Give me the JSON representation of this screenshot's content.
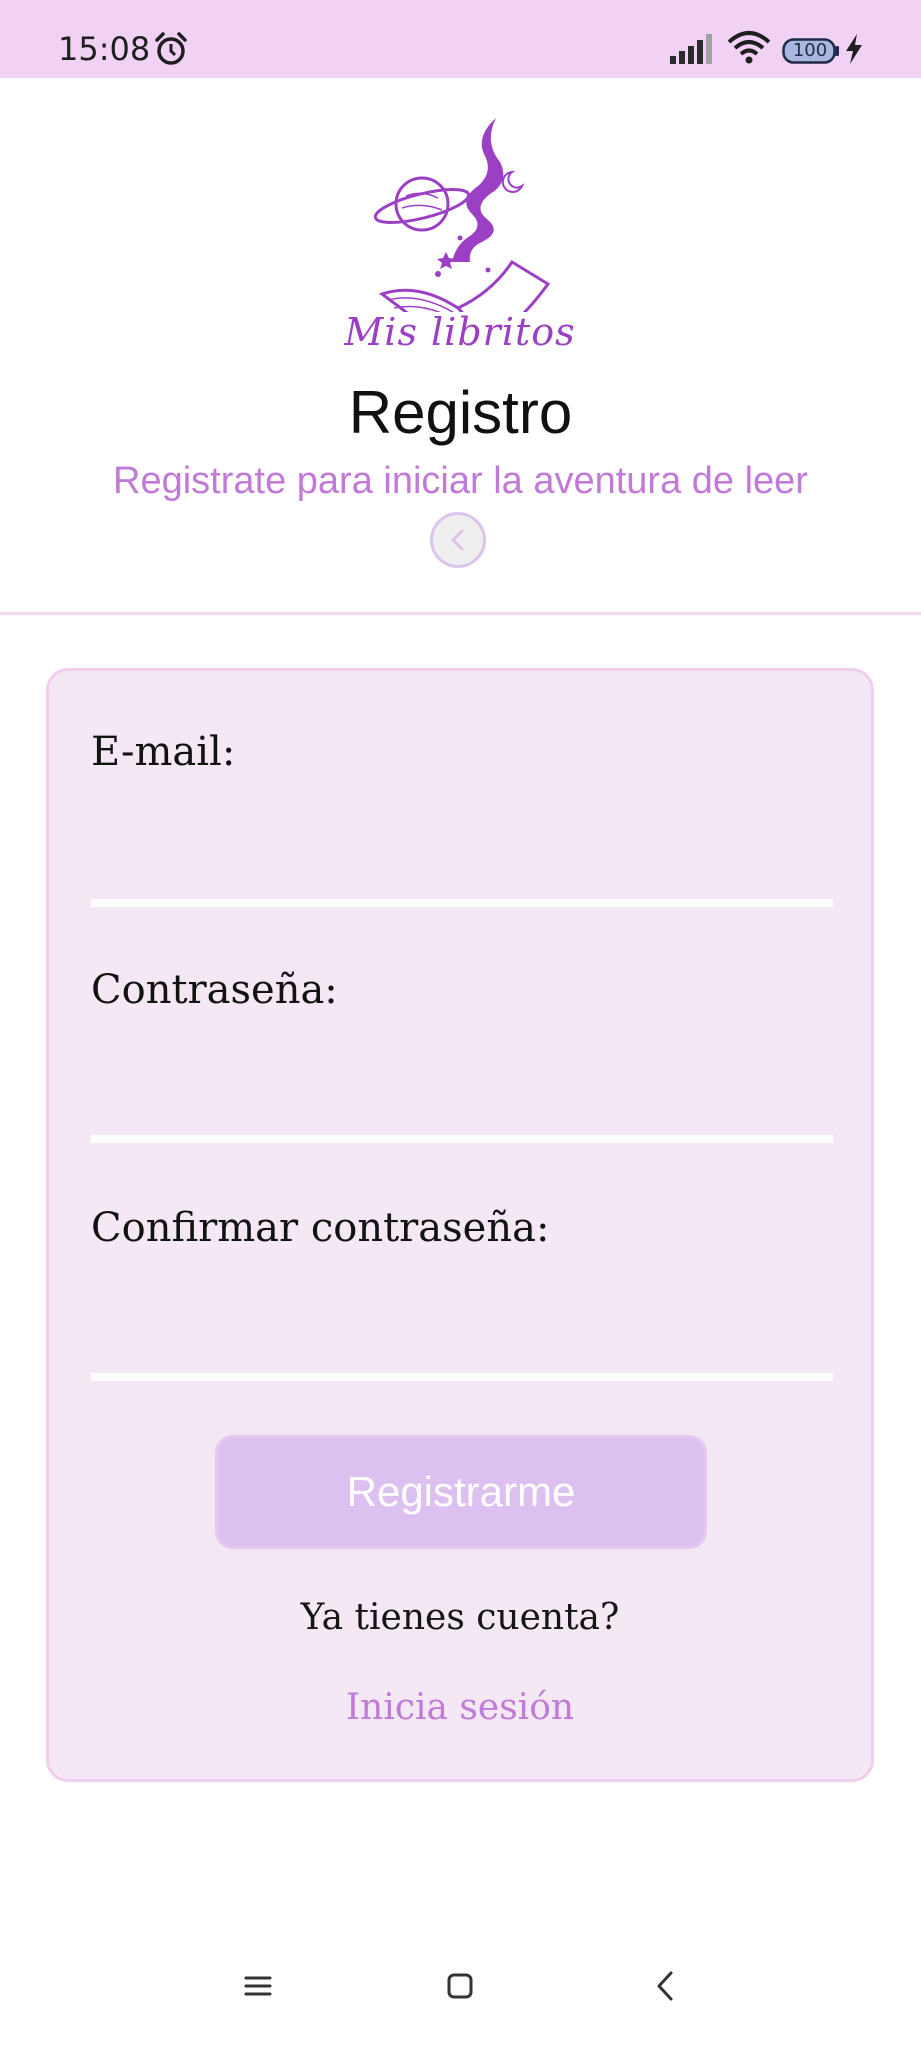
{
  "status_bar": {
    "time": "15:08",
    "battery_level": "100",
    "icons": [
      "alarm-icon",
      "signal-icon",
      "wifi-icon",
      "battery-icon",
      "charging-bolt-icon"
    ]
  },
  "header": {
    "logo_text": "Mis libritos",
    "title": "Registro",
    "subtitle": "Registrate para iniciar la aventura de leer",
    "back_icon": "chevron-left-icon"
  },
  "form": {
    "email_label": "E-mail:",
    "email_value": "",
    "password_label": "Contraseña:",
    "password_value": "",
    "confirm_label": "Confirmar contraseña:",
    "confirm_value": "",
    "submit_label": "Registrarme",
    "account_question": "Ya tienes cuenta?",
    "login_link": "Inicia sesión"
  },
  "nav_bar": {
    "icons": [
      "menu-icon",
      "home-square-icon",
      "back-chevron-icon"
    ]
  },
  "colors": {
    "status_bar_bg": "#f1d2f4",
    "accent": "#c27ad8",
    "logo_purple": "#9b40c4",
    "card_bg": "#f3e8f4",
    "card_border": "#f1cdef",
    "button_bg": "#dcc0f0"
  }
}
